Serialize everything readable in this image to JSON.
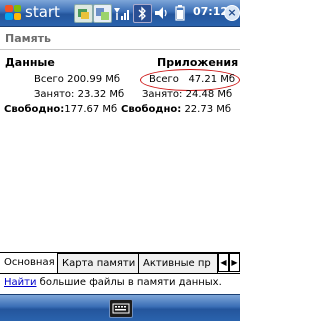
{
  "taskbar": {
    "start_label": "start",
    "clock": "07:12",
    "close_label": "×"
  },
  "page": {
    "title": "Память"
  },
  "data_column": {
    "heading": "Данные",
    "total_label": "Всего",
    "total_value": "200.99 Мб",
    "used_label": "Занято:",
    "used_value": "23.32 Мб",
    "free_label": "Свободно:",
    "free_value": "177.67 Мб"
  },
  "apps_column": {
    "heading": "Приложения",
    "total_label": "Всего",
    "total_value": "47.21 Мб",
    "used_label": "Занято:",
    "used_value": "24.48 Мб",
    "free_label": "Свободно:",
    "free_value": "22.73 Мб"
  },
  "tabs": [
    {
      "label": "Основная"
    },
    {
      "label": "Карта памяти"
    },
    {
      "label": "Активные пр"
    }
  ],
  "find": {
    "link_text": "Найти",
    "rest_text": " большие файлы в памяти данных."
  },
  "colors": {
    "highlight": "#cc1111",
    "link": "#0000cc"
  }
}
